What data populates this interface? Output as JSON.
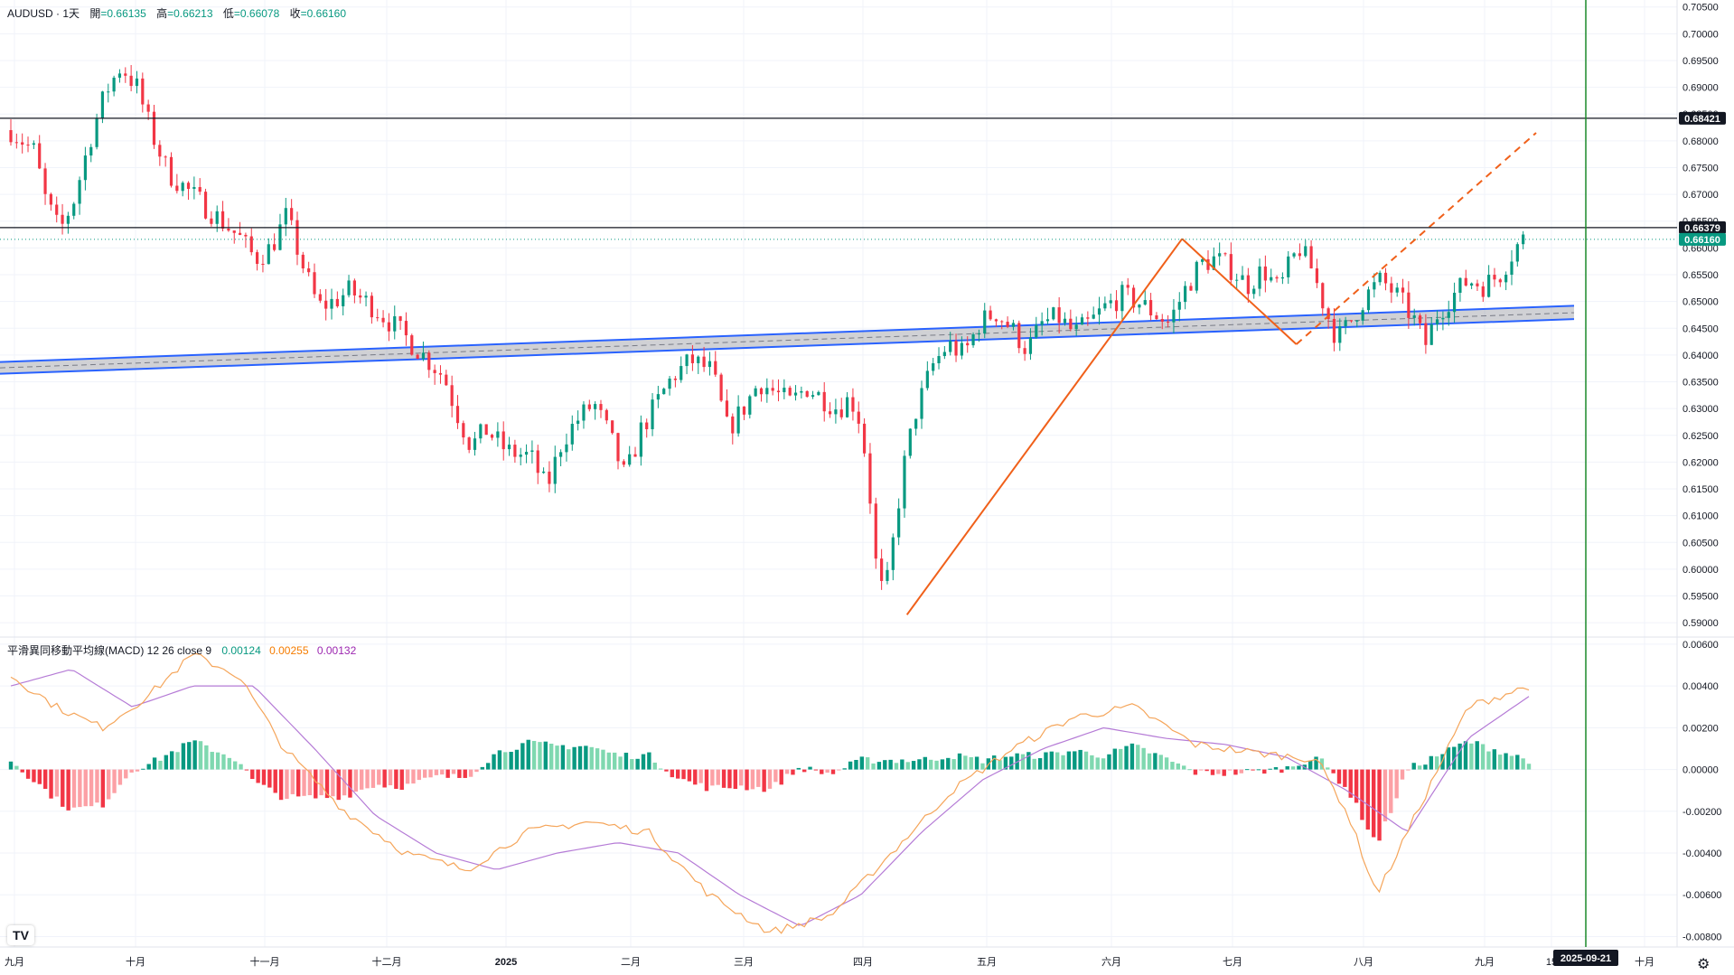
{
  "legend": {
    "symbol": "AUDUSD · 1天",
    "open_label": "開",
    "open": "=0.66135",
    "high_label": "高",
    "high": "=0.66213",
    "low_label": "低",
    "low": "=0.66078",
    "close_label": "收",
    "close": "=0.66160"
  },
  "macd": {
    "title": "平滑異同移動平均線(MACD) 12 26 close 9",
    "v1": "0.00124",
    "v2": "0.00255",
    "v3": "0.00132"
  },
  "logo": "TV",
  "chart_data": [
    {
      "type": "candlestick",
      "symbol": "AUDUSD",
      "interval": "1天",
      "price_ticks": [
        "0.70500",
        "0.70000",
        "0.69500",
        "0.69000",
        "0.68500",
        "0.68000",
        "0.67500",
        "0.67000",
        "0.66500",
        "0.66000",
        "0.65500",
        "0.65000",
        "0.64500",
        "0.64000",
        "0.63500",
        "0.63000",
        "0.62500",
        "0.62000",
        "0.61500",
        "0.61000",
        "0.60500",
        "0.60000",
        "0.59500",
        "0.59000"
      ],
      "ylim": [
        0.5875,
        0.7063
      ],
      "horizontal_lines": [
        {
          "value": 0.68421,
          "label": "0.68421"
        },
        {
          "value": 0.66379,
          "label": "0.66379"
        }
      ],
      "last_price": {
        "value": 0.6616,
        "label": "0.66160"
      },
      "x_ticks": [
        "九月",
        "十月",
        "十一月",
        "十二月",
        "2025",
        "二月",
        "三月",
        "四月",
        "五月",
        "六月",
        "七月",
        "八月",
        "九月",
        "15",
        "十月"
      ],
      "vertical_marker": {
        "label": "2025-09-21"
      },
      "channel": {
        "upper": [
          0.6387,
          0.6492
        ],
        "lower": [
          0.6365,
          0.6467
        ],
        "mid": [
          0.6376,
          0.6479
        ]
      },
      "pattern_points": [
        {
          "t": 0.5875,
          "v": 0.5915
        },
        {
          "t": 0.7679,
          "v": 0.6617
        },
        {
          "t": 0.8428,
          "v": 0.642
        },
        {
          "t": 1.0,
          "v": 0.6815
        }
      ],
      "path": [
        [
          0.0,
          0.682
        ],
        [
          0.015,
          0.678
        ],
        [
          0.022,
          0.669
        ],
        [
          0.031,
          0.663
        ],
        [
          0.04,
          0.669
        ],
        [
          0.05,
          0.68
        ],
        [
          0.06,
          0.689
        ],
        [
          0.07,
          0.694
        ],
        [
          0.08,
          0.69
        ],
        [
          0.09,
          0.681
        ],
        [
          0.1,
          0.674
        ],
        [
          0.115,
          0.67
        ],
        [
          0.13,
          0.666
        ],
        [
          0.145,
          0.662
        ],
        [
          0.155,
          0.658
        ],
        [
          0.165,
          0.66
        ],
        [
          0.175,
          0.666
        ],
        [
          0.185,
          0.657
        ],
        [
          0.195,
          0.649
        ],
        [
          0.205,
          0.65
        ],
        [
          0.215,
          0.652
        ],
        [
          0.23,
          0.649
        ],
        [
          0.245,
          0.645
        ],
        [
          0.255,
          0.642
        ],
        [
          0.265,
          0.639
        ],
        [
          0.275,
          0.636
        ],
        [
          0.282,
          0.63
        ],
        [
          0.292,
          0.623
        ],
        [
          0.302,
          0.626
        ],
        [
          0.315,
          0.622
        ],
        [
          0.33,
          0.621
        ],
        [
          0.34,
          0.615
        ],
        [
          0.35,
          0.624
        ],
        [
          0.36,
          0.628
        ],
        [
          0.37,
          0.631
        ],
        [
          0.38,
          0.625
        ],
        [
          0.39,
          0.617
        ],
        [
          0.4,
          0.626
        ],
        [
          0.41,
          0.631
        ],
        [
          0.42,
          0.636
        ],
        [
          0.432,
          0.639
        ],
        [
          0.445,
          0.637
        ],
        [
          0.455,
          0.626
        ],
        [
          0.465,
          0.63
        ],
        [
          0.475,
          0.635
        ],
        [
          0.485,
          0.633
        ],
        [
          0.495,
          0.631
        ],
        [
          0.505,
          0.634
        ],
        [
          0.515,
          0.632
        ],
        [
          0.525,
          0.63
        ],
        [
          0.533,
          0.632
        ],
        [
          0.54,
          0.627
        ],
        [
          0.546,
          0.612
        ],
        [
          0.55,
          0.598
        ],
        [
          0.555,
          0.595
        ],
        [
          0.56,
          0.605
        ],
        [
          0.566,
          0.618
        ],
        [
          0.574,
          0.629
        ],
        [
          0.585,
          0.638
        ],
        [
          0.595,
          0.642
        ],
        [
          0.605,
          0.64
        ],
        [
          0.615,
          0.646
        ],
        [
          0.625,
          0.648
        ],
        [
          0.635,
          0.645
        ],
        [
          0.645,
          0.641
        ],
        [
          0.655,
          0.646
        ],
        [
          0.665,
          0.647
        ],
        [
          0.675,
          0.644
        ],
        [
          0.685,
          0.646
        ],
        [
          0.695,
          0.649
        ],
        [
          0.705,
          0.651
        ],
        [
          0.715,
          0.65
        ],
        [
          0.725,
          0.648
        ],
        [
          0.735,
          0.646
        ],
        [
          0.745,
          0.652
        ],
        [
          0.755,
          0.657
        ],
        [
          0.765,
          0.658
        ],
        [
          0.775,
          0.656
        ],
        [
          0.785,
          0.653
        ],
        [
          0.795,
          0.656
        ],
        [
          0.805,
          0.652
        ],
        [
          0.812,
          0.657
        ],
        [
          0.818,
          0.66
        ],
        [
          0.826,
          0.656
        ],
        [
          0.835,
          0.648
        ],
        [
          0.842,
          0.643
        ],
        [
          0.85,
          0.646
        ],
        [
          0.86,
          0.651
        ],
        [
          0.87,
          0.654
        ],
        [
          0.88,
          0.651
        ],
        [
          0.89,
          0.647
        ],
        [
          0.898,
          0.642
        ],
        [
          0.906,
          0.648
        ],
        [
          0.915,
          0.651
        ],
        [
          0.925,
          0.654
        ],
        [
          0.935,
          0.653
        ],
        [
          0.945,
          0.655
        ],
        [
          0.955,
          0.66
        ],
        [
          0.96,
          0.6616
        ]
      ]
    },
    {
      "type": "macd",
      "title": "平滑異同移動平均線(MACD) 12 26 close 9",
      "params": [
        12,
        26,
        "close",
        9
      ],
      "values": {
        "histogram": 0.00124,
        "macd": 0.00255,
        "signal": 0.00132
      },
      "value_ticks": [
        "0.00600",
        "0.00400",
        "0.00200",
        "0.00000",
        "-0.00200",
        "-0.00400",
        "-0.00600",
        "-0.00800"
      ],
      "ylim": [
        -0.0085,
        0.0063
      ],
      "colors": {
        "macd": "#f5a55a",
        "signal": "#b57bd6",
        "hist_up_strong": "#089981",
        "hist_up_weak": "#7fd8b0",
        "hist_down_strong": "#f23645",
        "hist_down_weak": "#fca0a5"
      }
    }
  ]
}
